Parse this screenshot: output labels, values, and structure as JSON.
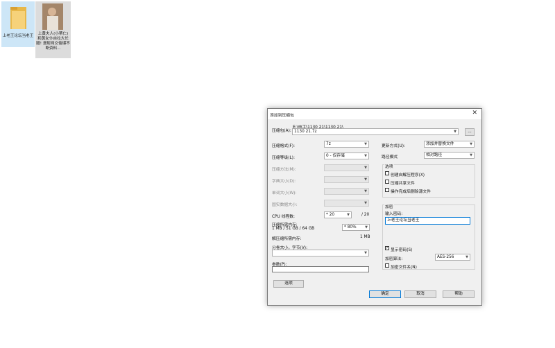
{
  "desktop": {
    "icons": [
      {
        "label": "上老王论坛当老王"
      },
      {
        "label": "上黄夫人(小蒂仁)和黄女仆自拉大长腿! 漫射网交偷爆不断资料..."
      }
    ]
  },
  "dialog": {
    "title": "添加到压缩包",
    "close": "✕",
    "archive": {
      "label": "压缩包(A):",
      "path": "E:\\电工\\1130 21\\1130 21\\",
      "name": "1130 21.7z",
      "browse": "..."
    },
    "left": {
      "format": {
        "label": "压缩格式(F):",
        "value": "7z"
      },
      "level": {
        "label": "压缩等级(L):",
        "value": "0 - 仅存储"
      },
      "method": {
        "label": "压缩方法(M):"
      },
      "dict": {
        "label": "字典大小(D):"
      },
      "word": {
        "label": "单词大小(W):"
      },
      "solid": {
        "label": "固实数据大小:"
      },
      "threads": {
        "label": "CPU 线程数:",
        "value": "* 20",
        "max": "/ 20"
      },
      "mem_usage": {
        "label": "压缩所需内存:",
        "detail": "1 MB / 51 GB / 64 GB",
        "percent": "* 80%"
      },
      "decomp_mem": {
        "label": "解压缩所需内存:",
        "value": "1 MB"
      },
      "split": {
        "label": "分卷大小，字节(V):"
      },
      "params": {
        "label": "参数(P):"
      },
      "options_button": "选项"
    },
    "right": {
      "update": {
        "label": "更新方式(U):",
        "value": "添加并替换文件"
      },
      "pathmode": {
        "label": "路径模式",
        "value": "相对路径"
      },
      "options": {
        "title": "选项",
        "sfx": "创建自解压程序(X)",
        "shared": "压缩共享文件",
        "delete": "操作完成后删除源文件"
      },
      "encryption": {
        "title": "加密",
        "pw_label": "输入密码:",
        "password": "上老王论坛当老王",
        "show_pw": "显示密码(S)",
        "method_label": "加密算法:",
        "method": "AES-256",
        "encrypt_names": "加密文件名(N)"
      }
    },
    "buttons": {
      "ok": "确定",
      "cancel": "取消",
      "help": "帮助"
    }
  }
}
